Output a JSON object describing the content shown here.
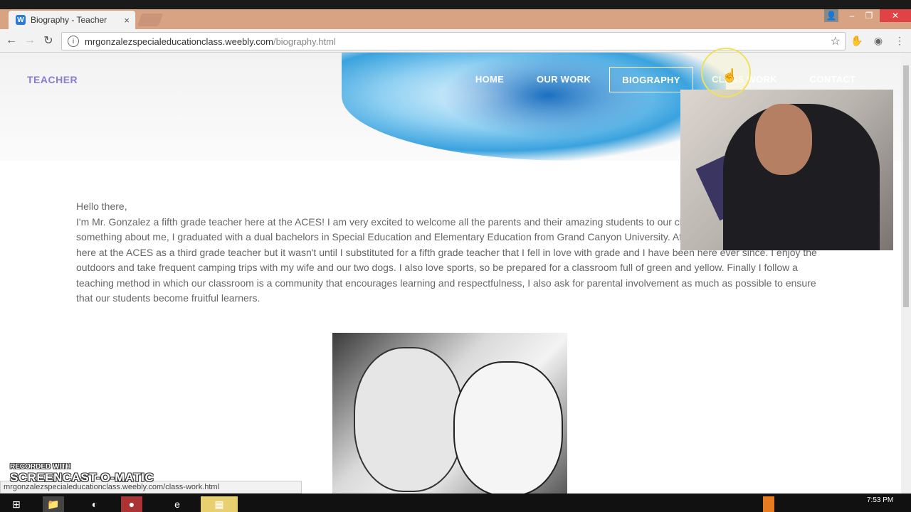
{
  "browser": {
    "tab_title": "Biography - Teacher",
    "tab_close": "×",
    "favicon": "W",
    "url_domain": "mrgonzalezspecialeducationclass.weebly.com",
    "url_path": "/biography.html",
    "status_url": "mrgonzalezspecialeducationclass.weebly.com/class-work.html"
  },
  "site": {
    "brand": "TEACHER",
    "nav": [
      {
        "label": "HOME"
      },
      {
        "label": "OUR WORK"
      },
      {
        "label": "BIOGRAPHY"
      },
      {
        "label": "CLASS WORK"
      },
      {
        "label": "CONTACT"
      }
    ],
    "greeting": "Hello there,",
    "bio": "I'm Mr. Gonzalez a fifth grade teacher here at the ACES! I am very excited to welcome all the parents and their amazing students to our classroom. Just to tell you a little something about me, I graduated with a dual bachelors in Special Education and Elementary Education from Grand Canyon University. After graduation I began working here at the ACES as a third grade teacher but it wasn't until I substituted for a fifth grade teacher that I fell in love with grade and I have been here ever since. I enjoy the outdoors and take frequent camping trips with my wife and our two dogs. I also love sports, so be prepared for a classroom full of green and yellow. Finally I follow a teaching method in which our classroom is a community that encourages learning and respectfulness, I also ask for parental involvement as much as possible to ensure that our students become fruitful learners."
  },
  "watermark": {
    "line1": "RECORDED WITH",
    "line2": "SCREENCAST-O-MATIC"
  },
  "taskbar": {
    "time": "7:53 PM"
  },
  "icons": {
    "back": "back-arrow-icon",
    "forward": "forward-arrow-icon",
    "reload": "reload-icon",
    "star": "star-icon",
    "menu": "menu-icon"
  },
  "colors": {
    "brand": "#8a7ad6",
    "tabstrip": "#d8a383",
    "text": "#666666"
  }
}
